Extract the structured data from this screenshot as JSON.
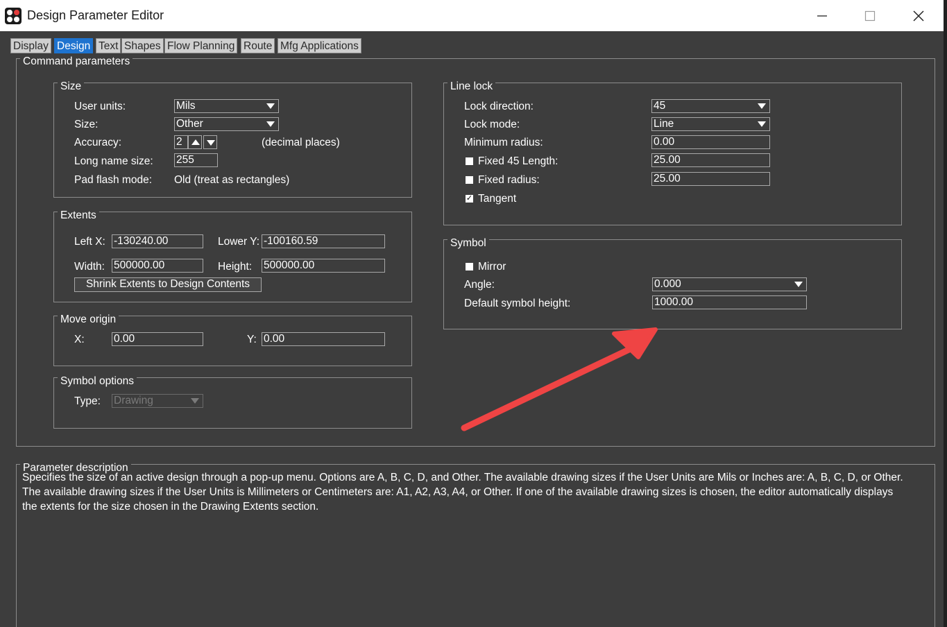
{
  "window": {
    "title": "Design Parameter Editor"
  },
  "tabs": [
    {
      "label": "Display"
    },
    {
      "label": "Design",
      "active": true
    },
    {
      "label": "Text"
    },
    {
      "label": "Shapes"
    },
    {
      "label": "Flow Planning"
    },
    {
      "label": "Route"
    },
    {
      "label": "Mfg Applications"
    }
  ],
  "command_parameters": {
    "label": "Command parameters",
    "size": {
      "label": "Size",
      "user_units_label": "User units:",
      "user_units_value": "Mils",
      "size_label": "Size:",
      "size_value": "Other",
      "accuracy_label": "Accuracy:",
      "accuracy_value": "2",
      "accuracy_suffix": "(decimal places)",
      "long_name_label": "Long name size:",
      "long_name_value": "255",
      "pad_flash_label": "Pad flash mode:",
      "pad_flash_value": "Old (treat as rectangles)"
    },
    "extents": {
      "label": "Extents",
      "left_x_label": "Left X:",
      "left_x_value": "-130240.00",
      "lower_y_label": "Lower Y:",
      "lower_y_value": "-100160.59",
      "width_label": "Width:",
      "width_value": "500000.00",
      "height_label": "Height:",
      "height_value": "500000.00",
      "shrink_button": "Shrink Extents to Design Contents"
    },
    "move_origin": {
      "label": "Move origin",
      "x_label": "X:",
      "x_value": "0.00",
      "y_label": "Y:",
      "y_value": "0.00"
    },
    "symbol_options": {
      "label": "Symbol options",
      "type_label": "Type:",
      "type_value": "Drawing"
    },
    "line_lock": {
      "label": "Line lock",
      "lock_direction_label": "Lock direction:",
      "lock_direction_value": "45",
      "lock_mode_label": "Lock mode:",
      "lock_mode_value": "Line",
      "min_radius_label": "Minimum radius:",
      "min_radius_value": "0.00",
      "fixed45_label": "Fixed 45 Length:",
      "fixed45_value": "25.00",
      "fixed45_checked": false,
      "fixed_radius_label": "Fixed radius:",
      "fixed_radius_value": "25.00",
      "fixed_radius_checked": false,
      "tangent_label": "Tangent",
      "tangent_checked": true,
      "check_mark": "✓"
    },
    "symbol": {
      "label": "Symbol",
      "mirror_label": "Mirror",
      "mirror_checked": false,
      "angle_label": "Angle:",
      "angle_value": "0.000",
      "default_height_label": "Default symbol height:",
      "default_height_value": "1000.00"
    }
  },
  "parameter_description": {
    "label": "Parameter description",
    "line1": "Specifies the size of an active design through a pop-up menu. Options are A, B, C, D, and Other.  The available drawing sizes if the User Units are Mils or Inches are: A, B, C, D, or Other.",
    "line2": "The available drawing sizes if the User Units is Millimeters or Centimeters are: A1, A2, A3, A4, or Other. If one of the available drawing sizes is chosen, the editor automatically displays",
    "line3": "the extents for the size chosen in the Drawing Extents section."
  },
  "colors": {
    "background": "#3d3d3d",
    "active_tab": "#1e73cf",
    "annotation_arrow": "#ef4444"
  }
}
